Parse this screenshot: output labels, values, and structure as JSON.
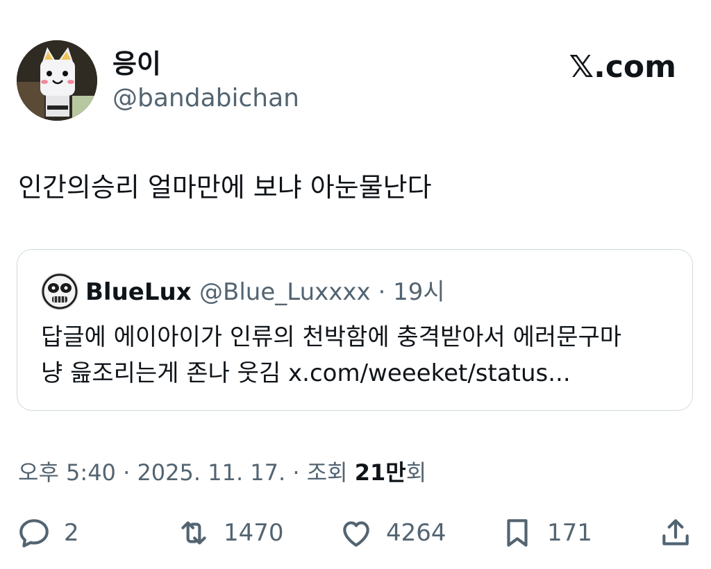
{
  "author": {
    "display_name": "응이",
    "handle": "@bandabichan"
  },
  "brand": "𝕏.com",
  "tweet_text": "인간의승리 얼마만에 보냐 아눈물난다",
  "quote": {
    "display_name": "BlueLux",
    "handle": "@Blue_Luxxxx",
    "separator": "·",
    "time": "19시",
    "line1": "답글에 에이아이가 인류의 천박함에 충격받아서 에러문구마",
    "line2": "냥 읊조리는게 존나 웃김 x.com/weeeket/status..."
  },
  "meta": {
    "time": "오후 5:40",
    "sep1": "·",
    "date": "2025. 11. 17.",
    "sep2": "·",
    "views_label": "조회",
    "views_value": "21만",
    "views_suffix": "회"
  },
  "actions": {
    "reply_count": "2",
    "repost_count": "1470",
    "like_count": "4264",
    "bookmark_count": "171"
  },
  "colors": {
    "text": "#0f1419",
    "secondary": "#536471",
    "border": "#cfd9de"
  },
  "icons": [
    "reply-icon",
    "repost-icon",
    "like-icon",
    "bookmark-icon",
    "share-icon"
  ]
}
